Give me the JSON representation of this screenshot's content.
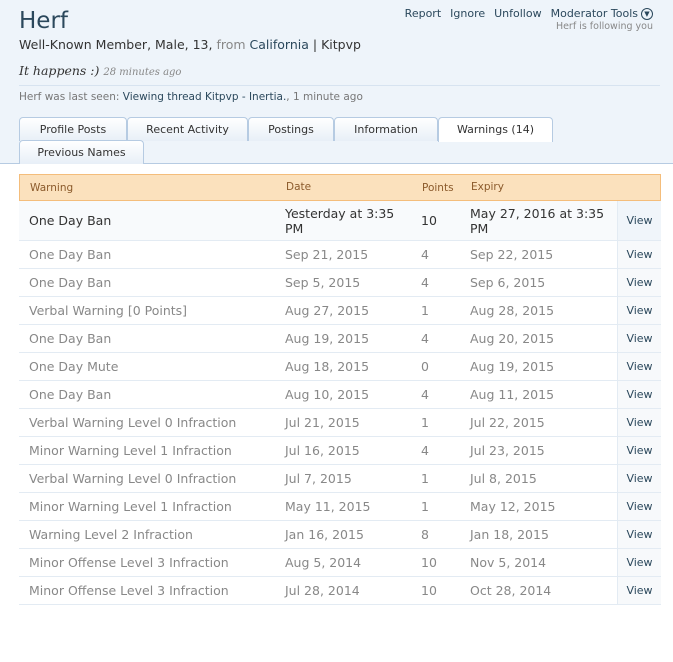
{
  "profile": {
    "username": "Herf",
    "title": "Well-Known Member, Male, 13,",
    "from_label": "from",
    "location": "California",
    "separator": "|",
    "server": "Kitpvp",
    "status": "It happens :)",
    "status_time": "28 minutes ago",
    "last_seen_prefix": "Herf was last seen:",
    "last_seen_activity": "Viewing thread",
    "last_seen_thread": "Kitpvp - Inertia.",
    "last_seen_sep": ",",
    "last_seen_time": "1 minute ago",
    "following": "Herf is following you"
  },
  "actions": {
    "report": "Report",
    "ignore": "Ignore",
    "unfollow": "Unfollow",
    "moderator_tools": "Moderator Tools"
  },
  "tabs": [
    "Profile Posts",
    "Recent Activity",
    "Postings",
    "Information",
    "Warnings (14)",
    "Previous Names"
  ],
  "table": {
    "headers": {
      "warning": "Warning",
      "date": "Date",
      "points": "Points",
      "expiry": "Expiry"
    },
    "view_label": "View",
    "rows": [
      {
        "warning": "One Day Ban",
        "date": "Yesterday at 3:35 PM",
        "points": "10",
        "expiry": "May 27, 2016 at 3:35 PM"
      },
      {
        "warning": "One Day Ban",
        "date": "Sep 21, 2015",
        "points": "4",
        "expiry": "Sep 22, 2015"
      },
      {
        "warning": "One Day Ban",
        "date": "Sep 5, 2015",
        "points": "4",
        "expiry": "Sep 6, 2015"
      },
      {
        "warning": "Verbal Warning [0 Points]",
        "date": "Aug 27, 2015",
        "points": "1",
        "expiry": "Aug 28, 2015"
      },
      {
        "warning": "One Day Ban",
        "date": "Aug 19, 2015",
        "points": "4",
        "expiry": "Aug 20, 2015"
      },
      {
        "warning": "One Day Mute",
        "date": "Aug 18, 2015",
        "points": "0",
        "expiry": "Aug 19, 2015"
      },
      {
        "warning": "One Day Ban",
        "date": "Aug 10, 2015",
        "points": "4",
        "expiry": "Aug 11, 2015"
      },
      {
        "warning": "Verbal Warning Level 0 Infraction",
        "date": "Jul 21, 2015",
        "points": "1",
        "expiry": "Jul 22, 2015"
      },
      {
        "warning": "Minor Warning Level 1 Infraction",
        "date": "Jul 16, 2015",
        "points": "4",
        "expiry": "Jul 23, 2015"
      },
      {
        "warning": "Verbal Warning Level 0 Infraction",
        "date": "Jul 7, 2015",
        "points": "1",
        "expiry": "Jul 8, 2015"
      },
      {
        "warning": "Minor Warning Level 1 Infraction",
        "date": "May 11, 2015",
        "points": "1",
        "expiry": "May 12, 2015"
      },
      {
        "warning": "Warning Level 2 Infraction",
        "date": "Jan 16, 2015",
        "points": "8",
        "expiry": "Jan 18, 2015"
      },
      {
        "warning": "Minor Offense Level 3 Infraction",
        "date": "Aug 5, 2014",
        "points": "10",
        "expiry": "Nov 5, 2014"
      },
      {
        "warning": "Minor Offense Level 3 Infraction",
        "date": "Jul 28, 2014",
        "points": "10",
        "expiry": "Oct 28, 2014"
      }
    ]
  }
}
